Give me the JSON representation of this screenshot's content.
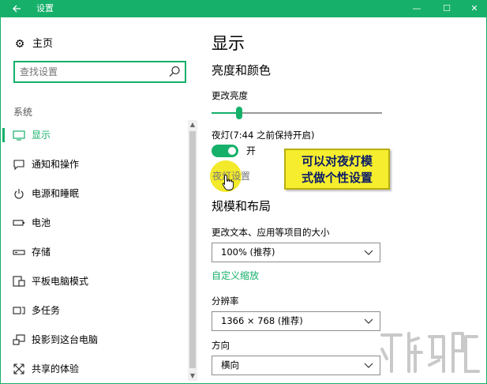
{
  "window": {
    "title": "设置",
    "back_icon": "back-arrow-icon",
    "controls": {
      "minimize": "—",
      "maximize": "☐",
      "close": "✕"
    },
    "accent_color": "#16b06a"
  },
  "sidebar": {
    "home_label": "主页",
    "home_icon": "gear-icon",
    "search_placeholder": "查找设置",
    "search_icon": "search-icon",
    "section_label": "系统",
    "items": [
      {
        "label": "显示",
        "icon": "monitor-icon",
        "active": true
      },
      {
        "label": "通知和操作",
        "icon": "message-icon",
        "active": false
      },
      {
        "label": "电源和睡眠",
        "icon": "power-icon",
        "active": false
      },
      {
        "label": "电池",
        "icon": "battery-icon",
        "active": false
      },
      {
        "label": "存储",
        "icon": "storage-icon",
        "active": false
      },
      {
        "label": "平板电脑模式",
        "icon": "tablet-icon",
        "active": false
      },
      {
        "label": "多任务",
        "icon": "multitask-icon",
        "active": false
      },
      {
        "label": "投影到这台电脑",
        "icon": "project-icon",
        "active": false
      },
      {
        "label": "共享的体验",
        "icon": "share-icon",
        "active": false
      }
    ]
  },
  "main": {
    "page_title": "显示",
    "brightness": {
      "heading": "亮度和颜色",
      "label": "更改亮度",
      "level": 0.15
    },
    "night_light": {
      "label": "夜灯(7:44 之前保持开启)",
      "toggle_state": "开",
      "settings_link": "夜灯设置"
    },
    "callout": {
      "line1": "可以对夜灯模",
      "line2": "式做个性设置"
    },
    "scale_layout": {
      "heading": "规模和布局",
      "size_label": "更改文本、应用等项目的大小",
      "size_value": "100% (推荐)",
      "custom_link": "自定义缩放",
      "resolution_label": "分辨率",
      "resolution_value": "1366 × 768 (推荐)",
      "orientation_label": "方向",
      "orientation_value": "横向"
    }
  }
}
